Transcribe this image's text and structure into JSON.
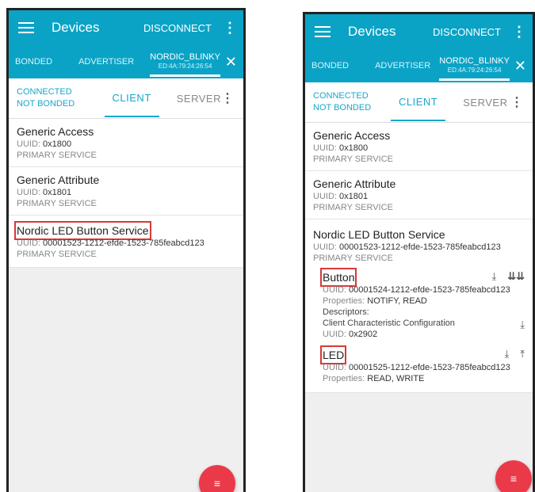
{
  "app": {
    "title": "Devices",
    "disconnect_label": "DISCONNECT",
    "accent_color": "#0aa3c6",
    "fab_color": "#ea3a4a"
  },
  "tabs": {
    "bonded": "BONDED",
    "advertiser": "ADVERTISER",
    "device_name": "NORDIC_BLINKY",
    "device_address": "ED:4A:79:24:26:54"
  },
  "status": {
    "connected": "CONNECTED",
    "bonded": "NOT BONDED",
    "client": "CLIENT",
    "server": "SERVER"
  },
  "services": [
    {
      "name": "Generic Access",
      "uuid_label": "UUID:",
      "uuid": "0x1800",
      "type": "PRIMARY SERVICE"
    },
    {
      "name": "Generic Attribute",
      "uuid_label": "UUID:",
      "uuid": "0x1801",
      "type": "PRIMARY SERVICE"
    },
    {
      "name": "Nordic LED Button Service",
      "uuid_label": "UUID:",
      "uuid": "00001523-1212-efde-1523-785feabcd123",
      "type": "PRIMARY SERVICE"
    }
  ],
  "characteristics": [
    {
      "name": "Button",
      "uuid_label": "UUID:",
      "uuid": "00001524-1212-efde-1523-785feabcd123",
      "props_label": "Properties:",
      "props": "NOTIFY, READ",
      "descriptors_label": "Descriptors:",
      "descriptor_name": "Client Characteristic Configuration",
      "descriptor_uuid_label": "UUID:",
      "descriptor_uuid": "0x2902"
    },
    {
      "name": "LED",
      "uuid_label": "UUID:",
      "uuid": "00001525-1212-efde-1523-785feabcd123",
      "props_label": "Properties:",
      "props": "READ, WRITE"
    }
  ],
  "icons": {
    "read": "download-icon",
    "notify": "notify-toggle-icon",
    "write": "upload-icon",
    "close": "close-icon",
    "menu": "hamburger-menu-icon",
    "overflow": "overflow-menu-icon",
    "fab": "log-list-icon"
  }
}
